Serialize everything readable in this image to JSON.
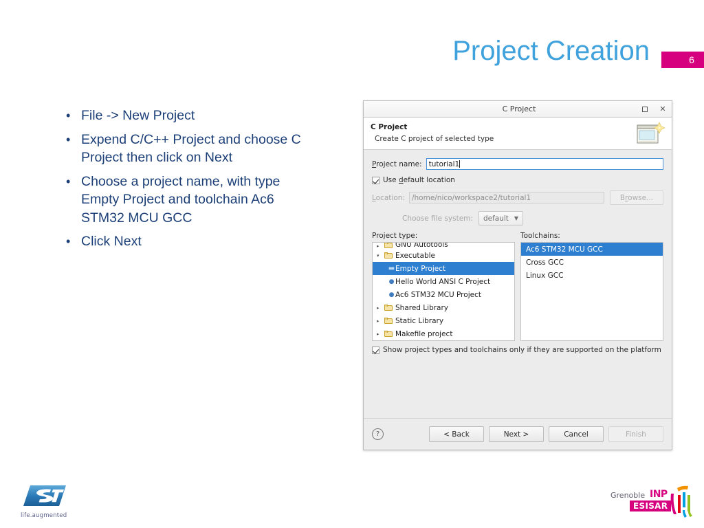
{
  "slide": {
    "title": "Project Creation",
    "page_number": "6",
    "title_color": "#3fa2dc",
    "badge_color": "#d6007f",
    "bullet_color": "#1c3f77"
  },
  "bullets": [
    "File -> New Project",
    "Expend C/C++ Project and choose C Project then click on Next",
    "Choose a project name, with type Empty Project and toolchain Ac6 STM32 MCU GCC",
    "Click Next"
  ],
  "dialog": {
    "titlebar": {
      "title": "C Project",
      "maximize_icon": "maximize-icon",
      "close_icon": "close-icon",
      "close_glyph": "✕"
    },
    "header": {
      "title": "C Project",
      "subtitle": "Create C project of selected type",
      "icon": "new-c-project-wizard-icon"
    },
    "project_name": {
      "label": "Project name:",
      "label_underlined": "P",
      "value": "tutorial1"
    },
    "use_default_location": {
      "label": "Use default location",
      "label_underlined": "d",
      "checked": true
    },
    "location": {
      "label": "Location:",
      "label_underlined": "L",
      "value": "/home/nico/workspace2/tutorial1",
      "browse_label": "Browse...",
      "browse_underlined": "r",
      "enabled": false
    },
    "file_system": {
      "label": "Choose file system:",
      "value": "default",
      "arrow_icon": "chevron-down-icon"
    },
    "project_type": {
      "label": "Project type:",
      "items": [
        {
          "label": "GNU Autotools",
          "level": 1,
          "marker": "folder",
          "arrow": "▸",
          "clipped": true,
          "selected": false
        },
        {
          "label": "Executable",
          "level": 1,
          "marker": "folder",
          "arrow": "▾",
          "clipped": false,
          "selected": false
        },
        {
          "label": "Empty Project",
          "level": 2,
          "marker": "dash",
          "arrow": "",
          "clipped": false,
          "selected": true
        },
        {
          "label": "Hello World ANSI C Project",
          "level": 2,
          "marker": "dot",
          "arrow": "",
          "clipped": false,
          "selected": false
        },
        {
          "label": "Ac6 STM32 MCU Project",
          "level": 2,
          "marker": "dot",
          "arrow": "",
          "clipped": false,
          "selected": false
        },
        {
          "label": "Shared Library",
          "level": 1,
          "marker": "folder",
          "arrow": "▸",
          "clipped": false,
          "selected": false
        },
        {
          "label": "Static Library",
          "level": 1,
          "marker": "folder",
          "arrow": "▸",
          "clipped": false,
          "selected": false
        },
        {
          "label": "Makefile project",
          "level": 1,
          "marker": "folder",
          "arrow": "▸",
          "clipped": false,
          "selected": false
        }
      ]
    },
    "toolchains": {
      "label": "Toolchains:",
      "items": [
        {
          "label": "Ac6 STM32 MCU GCC",
          "selected": true
        },
        {
          "label": "Cross GCC",
          "selected": false
        },
        {
          "label": "Linux GCC",
          "selected": false
        }
      ]
    },
    "show_supported": {
      "label": "Show project types and toolchains only if they are supported on the platform",
      "checked": true
    },
    "footer": {
      "help_icon": "help-icon",
      "help_glyph": "?",
      "buttons": [
        {
          "label": "< Back",
          "enabled": true
        },
        {
          "label": "Next >",
          "enabled": true
        },
        {
          "label": "Cancel",
          "enabled": true
        },
        {
          "label": "Finish",
          "enabled": false
        }
      ]
    },
    "selection_color": "#2f7fd0"
  },
  "logos": {
    "st": {
      "name": "st-logo",
      "tagline": "life.augmented"
    },
    "inp": {
      "name": "grenoble-inp-esisar-logo",
      "line1": "Grenoble",
      "line2": "INP",
      "line3": "ESISAR"
    }
  }
}
